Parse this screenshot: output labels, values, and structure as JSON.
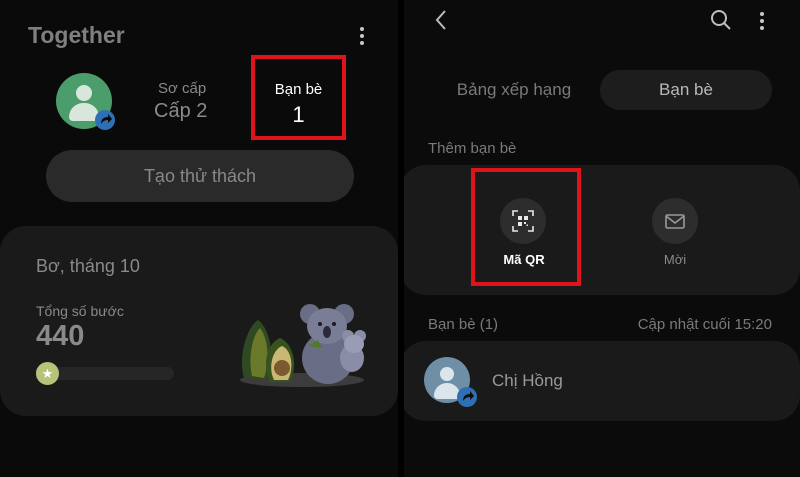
{
  "left": {
    "title": "Together",
    "level_label": "Sơ cấp",
    "level_value": "Cấp 2",
    "friends_label": "Bạn bè",
    "friends_count": "1",
    "challenge_button": "Tạo thử thách",
    "card": {
      "title": "Bơ, tháng 10",
      "steps_label": "Tổng số bước",
      "steps_value": "440",
      "progress_fraction": 0.05
    }
  },
  "right": {
    "tabs": [
      {
        "label": "Bảng xếp hạng",
        "active": false
      },
      {
        "label": "Bạn bè",
        "active": true
      }
    ],
    "add_friends_title": "Thêm bạn bè",
    "options": [
      {
        "label": "Mã QR",
        "icon": "qr-code-icon"
      },
      {
        "label": "Mời",
        "icon": "mail-icon"
      }
    ],
    "friends_count_label": "Bạn bè (1)",
    "last_update": "Cập nhật cuối 15:20",
    "friends": [
      {
        "name": "Chị Hồng"
      }
    ]
  },
  "colors": {
    "highlight_border": "#e0131b",
    "avatar_self": "#4c9d6c",
    "avatar_friend": "#6f8fa7",
    "share_badge": "#2f6fb3"
  }
}
